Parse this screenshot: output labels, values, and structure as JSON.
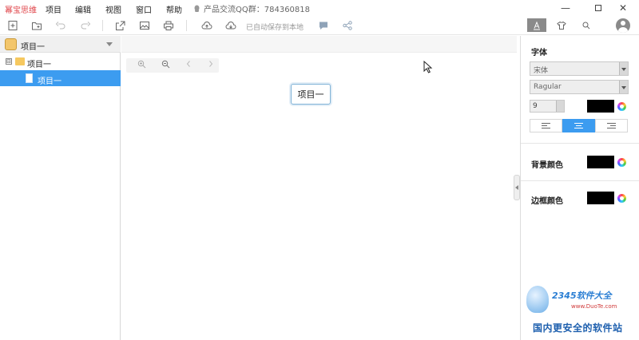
{
  "menubar": {
    "app_name": "幂宝思维",
    "items": [
      "项目",
      "编辑",
      "视图",
      "窗口",
      "帮助"
    ],
    "qq_text": "产品交流QQ群：784360818",
    "window_controls": [
      "minimize-icon",
      "maximize-icon",
      "close-icon"
    ]
  },
  "toolbar": {
    "autosave_text": "已自动保存到本地",
    "icons": [
      "new-file-icon",
      "new-folder-icon",
      "undo-icon",
      "redo-icon",
      "export-icon",
      "image-icon",
      "print-icon",
      "cloud-upload-icon",
      "cloud-download-icon",
      "comment-icon",
      "share-icon"
    ],
    "right_tabs": [
      "text-style-icon",
      "shirt-icon",
      "search-icon"
    ]
  },
  "left_panel": {
    "header_title": "项目一",
    "tree": {
      "folder_label": "项目一",
      "expand_symbol": "⊟",
      "doc_label": "项目一"
    }
  },
  "canvas": {
    "node_text": "项目一",
    "zoom_icons": [
      "zoom-in-icon",
      "zoom-out-icon",
      "prev-icon",
      "next-icon"
    ]
  },
  "right_panel": {
    "font_label": "字体",
    "font_family": "宋体",
    "font_weight": "Ragular",
    "font_size": "9",
    "font_color": "#000000",
    "alignment": [
      "left",
      "center",
      "right"
    ],
    "active_alignment": "center",
    "bg_color_label": "背景颜色",
    "bg_color": "#000000",
    "border_color_label": "边框颜色",
    "border_color": "#000000"
  },
  "watermark": {
    "brand": "2345软件大全",
    "url": "www.DuoTe.com",
    "slogan": "国内更安全的软件站"
  },
  "colors": {
    "accent": "#3c9cf0",
    "app_name": "#e0474c"
  }
}
